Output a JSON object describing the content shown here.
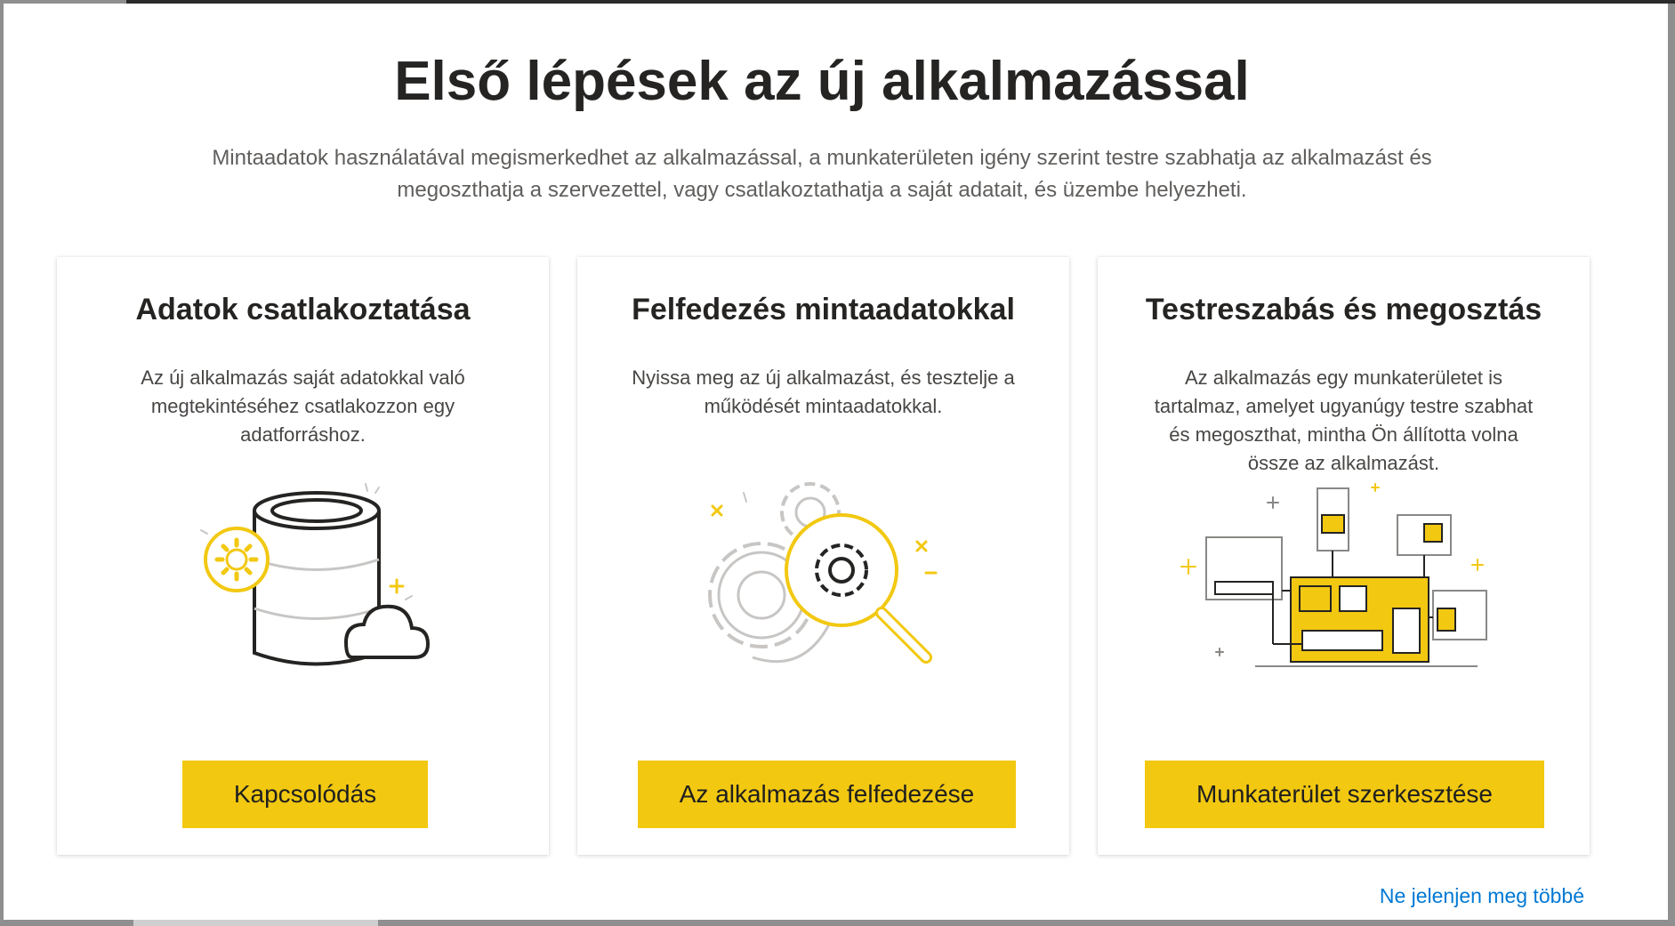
{
  "dialog": {
    "title": "Első lépések az új alkalmazással",
    "subtitle": "Mintaadatok használatával megismerkedhet az alkalmazással, a munkaterületen igény szerint testre szabhatja az alkal­mazást és megoszthatja a szervezettel, vagy csatlakoztathatja a saját adatait, és üzembe helyezheti."
  },
  "cards": [
    {
      "title": "Adatok csatlakoztatása",
      "description": "Az új alkalmazás saját adatokkal való megtekintéséhez csatlakozzon egy adatforráshoz.",
      "illustration_icon": "database-cloud-gear-icon",
      "button_label": "Kapcsolódás"
    },
    {
      "title": "Felfedezés mintaadatokkal",
      "description": "Nyissa meg az új alkalmazást, és tesztelje a működését mintaadatokkal.",
      "illustration_icon": "gears-magnifier-icon",
      "button_label": "Az alkalmazás felfedezése"
    },
    {
      "title": "Testreszabás és megosztás",
      "description": "Az alkalmazás egy munkaterületet is tartalmaz, amelyet ugyanúgy testre szabhat és megoszthat, mintha Ön állította volna össze az alkalmazást.",
      "illustration_icon": "dashboard-network-icon",
      "button_label": "Munkaterület szerkesztése"
    }
  ],
  "footer": {
    "dont_show_again": "Ne jelenjen meg többé"
  },
  "colors": {
    "accent": "#f2c811",
    "link": "#0078d4",
    "title": "#252423",
    "text": "#605e5c"
  }
}
